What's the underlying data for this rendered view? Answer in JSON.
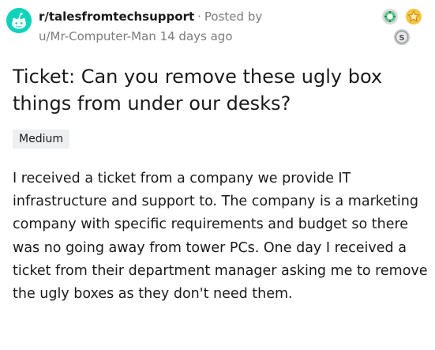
{
  "post": {
    "subreddit": "r/talesfromtechsupport",
    "dot": "·",
    "posted_by_label": "Posted by",
    "author": "u/Mr-Computer-Man",
    "age": "14 days ago",
    "title": "Ticket: Can you remove these ugly box things from under our desks?",
    "flair": "Medium",
    "body": "I received a ticket from a company we provide IT infrastructure and support to. The company is a marketing company with specific requirements and budget so there was no going away from tower PCs. One day I received a ticket from their department manager asking me to remove the ugly boxes as they don't need them."
  },
  "icons": {
    "avatar": "subreddit-avatar-icon",
    "awards": [
      "helpful-award-icon",
      "gold-star-award-icon",
      "silver-award-icon"
    ]
  },
  "colors": {
    "avatar_bg": "#0dd3bb",
    "meta_gray": "#7c7c7c",
    "flair_bg": "#edeff1",
    "text": "#1a1a1b"
  }
}
